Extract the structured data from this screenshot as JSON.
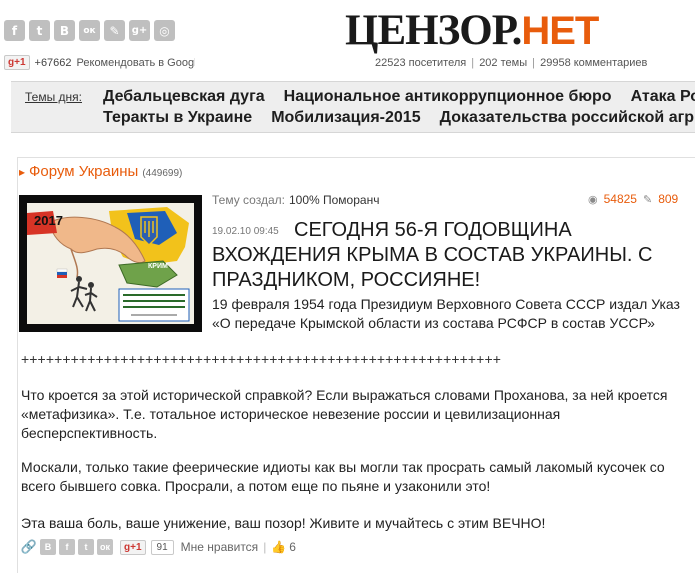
{
  "header": {
    "social_icons": [
      {
        "icon": "facebook-icon",
        "glyph": "f"
      },
      {
        "icon": "twitter-icon",
        "glyph": "t"
      },
      {
        "icon": "vkontakte-icon",
        "glyph": "В"
      },
      {
        "icon": "odnoklassniki-icon",
        "glyph": "ок"
      },
      {
        "icon": "livejournal-icon",
        "glyph": "✎"
      },
      {
        "icon": "googleplus-icon",
        "glyph": "g+"
      },
      {
        "icon": "rss-icon",
        "glyph": "◎"
      }
    ],
    "gplus_button": "g+1",
    "gplus_count": "+67662",
    "gplus_text": "Рекомендовать в Google",
    "logo_left": "ЦЕНЗОР",
    "logo_dot": ".",
    "logo_right": "НЕТ",
    "stats": {
      "visitors": "22523 посетителя",
      "topics": "202 темы",
      "comments": "29958 комментариев",
      "separator": "|"
    }
  },
  "topics_bar": {
    "label": "Темы дня:",
    "row1": [
      "Дебальцевская дуга",
      "Национальное антикоррупционное бюро",
      "Атака Россі"
    ],
    "row2": [
      "Теракты в Украине",
      "Мобилизация-2015",
      "Доказательства российской агр"
    ]
  },
  "forum": {
    "arrow": "▸",
    "name": "Форум Украины",
    "count": "(449699)"
  },
  "post": {
    "creator_label": "Тему создал:",
    "creator_name": "100% Поморанч",
    "views": "54825",
    "comments": "809",
    "date": "19.02.10 09:45",
    "title": "Сегодня 56-я годовщина вхождения Крыма в состав Украины. С праздником, россияне!",
    "lead": "19 февраля 1954 года Президиум Верховного Совета СССР издал Указ «О передаче Крымской области из состава РСФСР в состав УССР»",
    "thumb": {
      "year": "2017",
      "crimea": "КРИМ",
      "caption": "На території України не допускається розміщення іноземних військових баз. Стаття 17 Конституції України"
    },
    "plus_line": "++++++++++++++++++++++++++++++++++++++++++++++++++++++++++",
    "paragraphs": [
      "Что кроется за этой исторической справкой? Если выражаться словами Проханова, за ней кроется «метафизика». Т.е. тотальное историческое невезение россии и цевилизационная бесперспективность.",
      "Москали, только такие феерические идиоты как вы могли так просрать самый лакомый кусочек со всего бывшего совка. Просрали, а потом еще по пьяне и узаконили это!",
      "Эта ваша боль, ваше унижение, ваш позор! Живите и мучайтесь с этим ВЕЧНО!"
    ],
    "share": {
      "gplus_button": "g+1",
      "gplus_count": "91",
      "like_text": "Мне нравится",
      "like_separator": "|",
      "like_count": "6"
    }
  },
  "colors": {
    "accent": "#e85c0c",
    "topics_bg": "#eeeeee",
    "icon_gray": "#bfbfbf"
  }
}
